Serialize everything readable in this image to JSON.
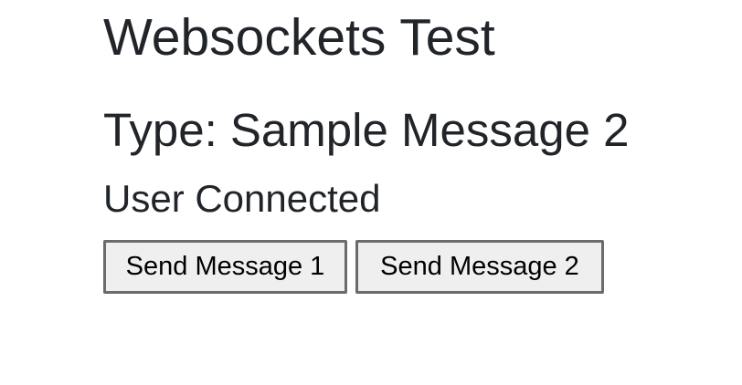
{
  "page": {
    "title": "Websockets Test",
    "message_type_line": "Type: Sample Message 2",
    "status": "User Connected"
  },
  "buttons": {
    "send_message_1": "Send Message 1",
    "send_message_2": "Send Message 2"
  },
  "colors": {
    "text": "#212529",
    "button_bg": "#efefef",
    "button_border": "#6b6b6b",
    "background": "#ffffff"
  }
}
